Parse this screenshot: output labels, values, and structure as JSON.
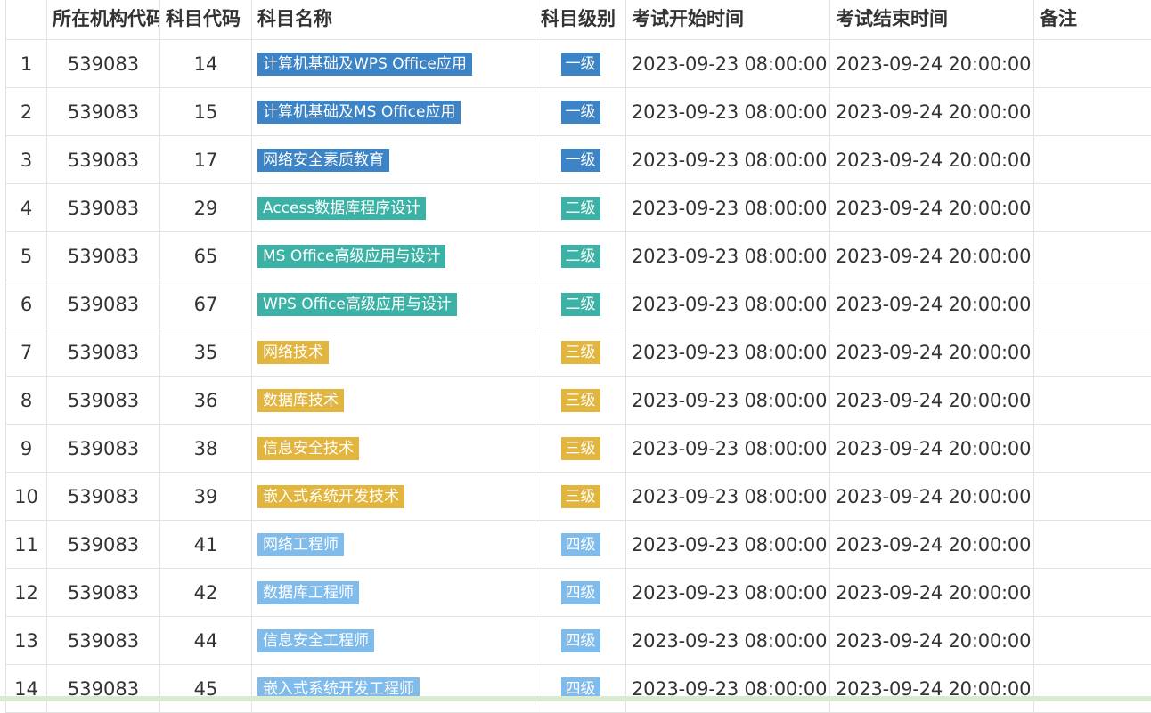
{
  "table": {
    "headers": [
      "",
      "所在机构代码",
      "科目代码",
      "科目名称",
      "科目级别",
      "考试开始时间",
      "考试结束时间",
      "备注"
    ],
    "colors": {
      "一级": "#3d84c6",
      "二级": "#3cb2a6",
      "三级": "#e2b53e",
      "四级": "#7fbcec"
    },
    "rows": [
      {
        "idx": "1",
        "org": "539083",
        "code": "14",
        "name": "计算机基础及WPS Office应用",
        "level": "一级",
        "start": "2023-09-23 08:00:00",
        "end": "2023-09-24 20:00:00",
        "note": ""
      },
      {
        "idx": "2",
        "org": "539083",
        "code": "15",
        "name": "计算机基础及MS Office应用",
        "level": "一级",
        "start": "2023-09-23 08:00:00",
        "end": "2023-09-24 20:00:00",
        "note": ""
      },
      {
        "idx": "3",
        "org": "539083",
        "code": "17",
        "name": "网络安全素质教育",
        "level": "一级",
        "start": "2023-09-23 08:00:00",
        "end": "2023-09-24 20:00:00",
        "note": ""
      },
      {
        "idx": "4",
        "org": "539083",
        "code": "29",
        "name": "Access数据库程序设计",
        "level": "二级",
        "start": "2023-09-23 08:00:00",
        "end": "2023-09-24 20:00:00",
        "note": ""
      },
      {
        "idx": "5",
        "org": "539083",
        "code": "65",
        "name": "MS Office高级应用与设计",
        "level": "二级",
        "start": "2023-09-23 08:00:00",
        "end": "2023-09-24 20:00:00",
        "note": ""
      },
      {
        "idx": "6",
        "org": "539083",
        "code": "67",
        "name": "WPS Office高级应用与设计",
        "level": "二级",
        "start": "2023-09-23 08:00:00",
        "end": "2023-09-24 20:00:00",
        "note": ""
      },
      {
        "idx": "7",
        "org": "539083",
        "code": "35",
        "name": "网络技术",
        "level": "三级",
        "start": "2023-09-23 08:00:00",
        "end": "2023-09-24 20:00:00",
        "note": ""
      },
      {
        "idx": "8",
        "org": "539083",
        "code": "36",
        "name": "数据库技术",
        "level": "三级",
        "start": "2023-09-23 08:00:00",
        "end": "2023-09-24 20:00:00",
        "note": ""
      },
      {
        "idx": "9",
        "org": "539083",
        "code": "38",
        "name": "信息安全技术",
        "level": "三级",
        "start": "2023-09-23 08:00:00",
        "end": "2023-09-24 20:00:00",
        "note": ""
      },
      {
        "idx": "10",
        "org": "539083",
        "code": "39",
        "name": "嵌入式系统开发技术",
        "level": "三级",
        "start": "2023-09-23 08:00:00",
        "end": "2023-09-24 20:00:00",
        "note": ""
      },
      {
        "idx": "11",
        "org": "539083",
        "code": "41",
        "name": "网络工程师",
        "level": "四级",
        "start": "2023-09-23 08:00:00",
        "end": "2023-09-24 20:00:00",
        "note": ""
      },
      {
        "idx": "12",
        "org": "539083",
        "code": "42",
        "name": "数据库工程师",
        "level": "四级",
        "start": "2023-09-23 08:00:00",
        "end": "2023-09-24 20:00:00",
        "note": ""
      },
      {
        "idx": "13",
        "org": "539083",
        "code": "44",
        "name": "信息安全工程师",
        "level": "四级",
        "start": "2023-09-23 08:00:00",
        "end": "2023-09-24 20:00:00",
        "note": ""
      },
      {
        "idx": "14",
        "org": "539083",
        "code": "45",
        "name": "嵌入式系统开发工程师",
        "level": "四级",
        "start": "2023-09-23 08:00:00",
        "end": "2023-09-24 20:00:00",
        "note": ""
      }
    ]
  }
}
